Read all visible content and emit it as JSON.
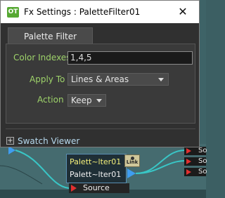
{
  "window": {
    "app_icon": "OT",
    "title": "Fx Settings : PaletteFilter01",
    "close_glyph": "✕"
  },
  "tab": {
    "label": "Palette Filter"
  },
  "fields": {
    "color_indexes": {
      "label": "Color Indexes",
      "value": "1,4,5"
    },
    "apply_to": {
      "label": "Apply To",
      "value": "Lines & Areas"
    },
    "action": {
      "label": "Action",
      "value": "Keep"
    }
  },
  "swatch_viewer": {
    "toggle": "+",
    "label": "Swatch Viewer"
  },
  "node_editor": {
    "filter_node": {
      "row1": "Palett~lter01",
      "row2": "Palett~lter01",
      "link_badge": "Link"
    },
    "source_node": {
      "label": "Source"
    },
    "right_nodes": [
      "So",
      "So",
      "So"
    ]
  },
  "colors": {
    "accent_label": "#9ed36a",
    "link_label": "#b6d9ee",
    "port_blue": "#3f9df0",
    "port_red": "#e23030",
    "wire": "#39c6c6"
  }
}
